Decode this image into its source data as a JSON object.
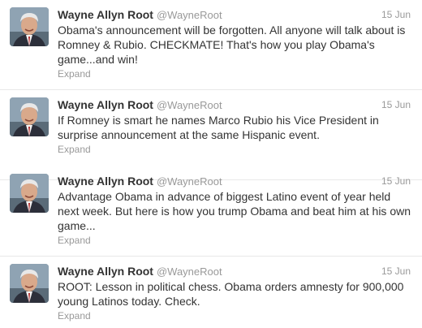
{
  "tweets": [
    {
      "name": "Wayne Allyn Root",
      "handle": "@WayneRoot",
      "time": "15 Jun",
      "text": "Obama's announcement will be forgotten. All anyone will talk about is Romney & Rubio. CHECKMATE! That's how you play Obama's game...and win!",
      "expand": "Expand"
    },
    {
      "name": "Wayne Allyn Root",
      "handle": "@WayneRoot",
      "time": "15 Jun",
      "text": "If Romney is smart he names Marco Rubio his Vice President in surprise announcement at the same Hispanic event.",
      "expand": "Expand"
    },
    {
      "name": "Wayne Allyn Root",
      "handle": "@WayneRoot",
      "time": "15 Jun",
      "text": "Advantage Obama in advance of biggest Latino event of year held next week. But here is how you trump Obama and beat him at his own game...",
      "expand": "Expand"
    },
    {
      "name": "Wayne Allyn Root",
      "handle": "@WayneRoot",
      "time": "15 Jun",
      "text": "ROOT: Lesson in political chess. Obama orders amnesty for 900,000 young Latinos today. Check.",
      "expand": "Expand"
    }
  ]
}
